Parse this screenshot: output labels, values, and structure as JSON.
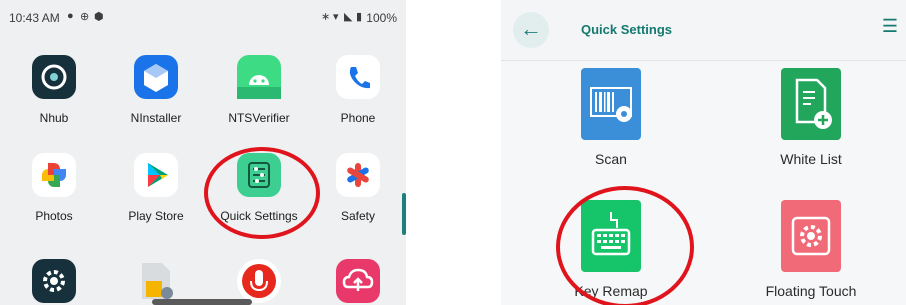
{
  "left": {
    "status_bar": {
      "time": "10:43 AM",
      "battery": "100%"
    },
    "apps": [
      {
        "label": "Nhub",
        "icon": "nhub-icon"
      },
      {
        "label": "NInstaller",
        "icon": "ninstaller-icon"
      },
      {
        "label": "NTSVerifier",
        "icon": "android-icon"
      },
      {
        "label": "Phone",
        "icon": "phone-icon"
      },
      {
        "label": "Photos",
        "icon": "pinwheel-icon"
      },
      {
        "label": "Play Store",
        "icon": "play-store-icon"
      },
      {
        "label": "Quick Settings",
        "icon": "quick-settings-icon"
      },
      {
        "label": "Safety",
        "icon": "safety-icon"
      }
    ],
    "highlighted_app": "Quick Settings"
  },
  "right": {
    "header": {
      "title": "Quick Settings"
    },
    "tiles": [
      {
        "label": "Scan",
        "icon": "barcode-gear-icon"
      },
      {
        "label": "White List",
        "icon": "document-plus-icon"
      },
      {
        "label": "Key Remap",
        "icon": "keyboard-icon"
      },
      {
        "label": "Floating Touch",
        "icon": "gear-icon"
      }
    ],
    "highlighted_tile": "Key Remap"
  },
  "colors": {
    "accent": "#16796f",
    "highlight_ring": "#e0141c"
  }
}
